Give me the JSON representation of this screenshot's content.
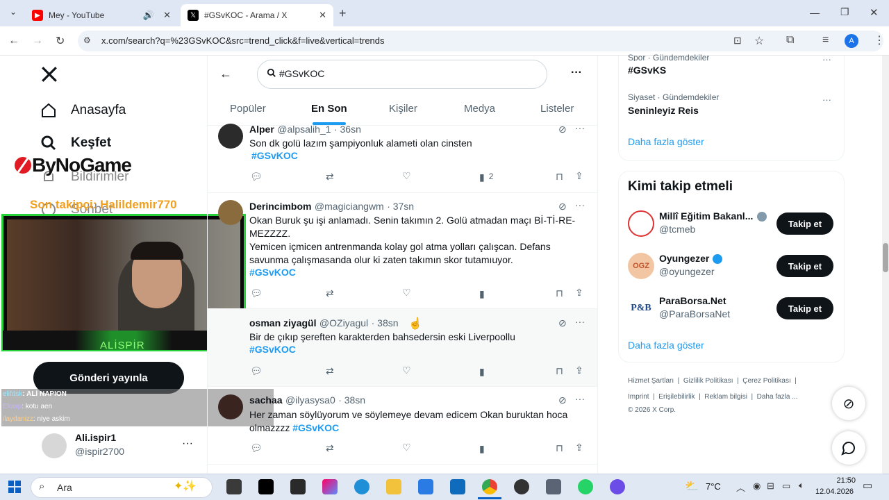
{
  "browser": {
    "tabs": [
      {
        "label": "Mey - YouTube"
      },
      {
        "label": "#GSvKOC - Arama / X"
      }
    ],
    "url": "x.com/search?q=%23GSvKOC&src=trend_click&f=live&vertical=trends",
    "profile_initial": "A"
  },
  "sidebar": {
    "items": [
      {
        "label": "Anasayfa"
      },
      {
        "label": "Keşfet"
      },
      {
        "label": "Bildirimler"
      },
      {
        "label": "Sohbet"
      }
    ],
    "post_button": "Gönderi yayınla",
    "account": {
      "name": "Ali.ispir1",
      "handle": "@ispir2700"
    }
  },
  "overlay": {
    "logo_text": "ByNoGame",
    "follower_label": "Son takipçi: Halildemir770",
    "cam_name": "ALİSPİR",
    "chat": [
      {
        "user": "elifdsk",
        "text": ": ALİ NAPION"
      },
      {
        "user": "Elowp",
        "text": ": kotu aen"
      },
      {
        "user": "ilaydanizz",
        "text": ": niye askim"
      }
    ]
  },
  "search": {
    "query": "#GSvKOC",
    "tabs": [
      "Popüler",
      "En Son",
      "Kişiler",
      "Medya",
      "Listeler"
    ],
    "active_tab": "En Son"
  },
  "tweets": [
    {
      "name": "Alper",
      "handle": "@alpsalih_1",
      "time": "· 36sn",
      "lines": [
        "Son dk golü lazım şampiyonluk alameti olan cinsten"
      ],
      "hashtag": "#GSvKOC",
      "views": "2"
    },
    {
      "name": "Derincimbom",
      "handle": "@magiciangwm",
      "time": "· 37sn",
      "lines": [
        "Okan Buruk şu işi anlamadı. Senin takımın 2. Golü atmadan maçı Bİ-Tİ-RE-",
        "MEZZZZ.",
        "Yemicen içmicen antrenmanda kolay gol atma yolları çalışcan. Defans",
        "savunma çalışmasanda olur ki zaten takımın skor tutamıuyor."
      ],
      "hashtag": "#GSvKOC",
      "views": ""
    },
    {
      "name": "osman ziyagül",
      "handle": "@OZiyagul",
      "time": "· 38sn",
      "lines": [
        "Bir de çıkıp şereften karakterden bahsedersin eski Liverpoollu"
      ],
      "hashtag": "#GSvKOC",
      "views": ""
    },
    {
      "name": "sachaa",
      "handle": "@ilyasysa0",
      "time": "· 38sn",
      "lines": [
        "Her zaman söylüyorum ve söylemeye devam edicem Okan buruktan hoca",
        "olmazzzz"
      ],
      "hashtag": "#GSvKOC",
      "views": ""
    }
  ],
  "trends": [
    {
      "category": "Spor · Gündemdekiler",
      "name": "#GSvKS"
    },
    {
      "category": "Siyaset · Gündemdekiler",
      "name": "Seninleyiz Reis"
    }
  ],
  "show_more": "Daha fazla göster",
  "who_to_follow": {
    "title": "Kimi takip etmeli",
    "accounts": [
      {
        "name": "Millî Eğitim Bakanl...",
        "handle": "@tcmeb",
        "button": "Takip et"
      },
      {
        "name": "Oyungezer",
        "handle": "@oyungezer",
        "button": "Takip et"
      },
      {
        "name": "ParaBorsa.Net",
        "handle": "@ParaBorsaNet",
        "button": "Takip et"
      }
    ],
    "show_more": "Daha fazla göster"
  },
  "footer": {
    "links": [
      "Hizmet Şartları",
      "Gizlilik Politikası",
      "Çerez Politikası",
      "Imprint",
      "Erişilebilirlik",
      "Reklam bilgisi",
      "Daha fazla ..."
    ],
    "copyright": "© 2026 X Corp."
  },
  "taskbar": {
    "search_placeholder": "Ara",
    "temperature": "7°C",
    "time": "21:50",
    "date": "12.04.2026"
  },
  "colors": {
    "accent": "#1d9bf0",
    "green_frame": "#27d13a",
    "orange_text": "#f0a020"
  }
}
